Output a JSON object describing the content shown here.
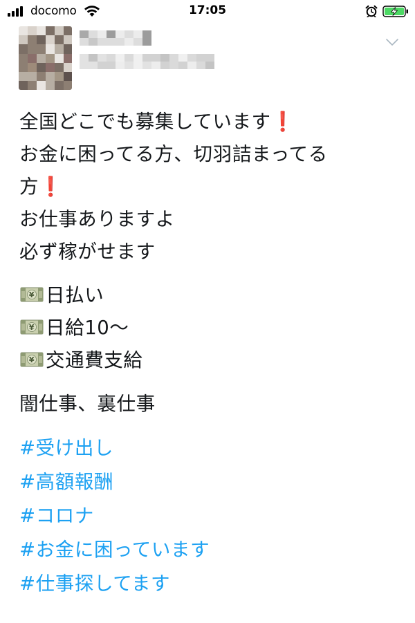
{
  "status_bar": {
    "carrier": "docomo",
    "time": "17:05",
    "icons": [
      "signal-bars-icon",
      "wifi-icon",
      "alarm-clock-icon",
      "battery-charging-icon"
    ],
    "battery_color": "#4cd964"
  },
  "tweet": {
    "author_blurred": true,
    "menu_icon": "chevron-down-icon",
    "paragraph1": [
      {
        "text": "全国どこでも募集しています",
        "emoji": "❗"
      },
      {
        "text": "お金に困ってる方、切羽詰まってる",
        "emoji": ""
      },
      {
        "text": "方",
        "emoji": "❗"
      },
      {
        "text": "お仕事ありますよ",
        "emoji": ""
      },
      {
        "text": "必ず稼がせます",
        "emoji": ""
      }
    ],
    "bullets": [
      {
        "icon": "yen-banknote-icon",
        "text": "日払い"
      },
      {
        "icon": "yen-banknote-icon",
        "text": "日給10〜"
      },
      {
        "icon": "yen-banknote-icon",
        "text": "交通費支給"
      }
    ],
    "paragraph3": "闇仕事、裏仕事",
    "hashtags": [
      "#受け出し",
      "#高額報酬",
      "#コロナ",
      "#お金に困っています",
      "#仕事探してます"
    ],
    "hashtag_color": "#1da1f2",
    "exclaim_color": "#e5233d"
  }
}
